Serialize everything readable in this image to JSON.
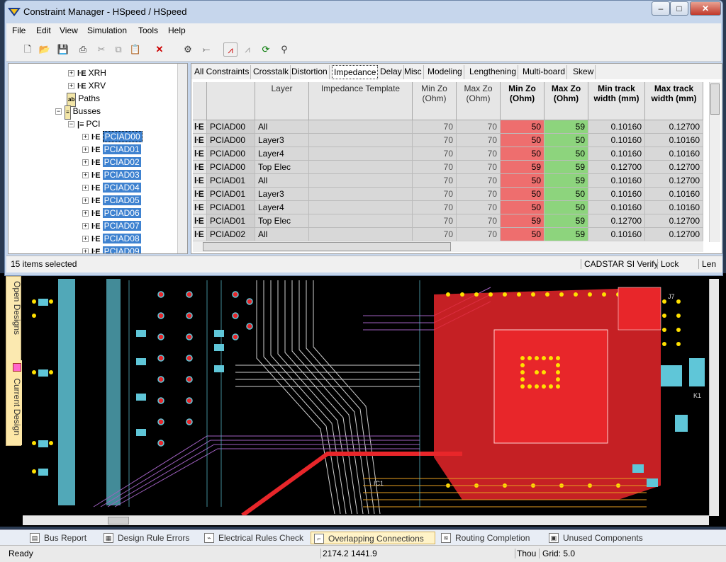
{
  "window": {
    "title": "Constraint Manager - HSpeed / HSpeed",
    "min": "–",
    "max": "□",
    "close": "✕"
  },
  "menu": [
    "File",
    "Edit",
    "View",
    "Simulation",
    "Tools",
    "Help"
  ],
  "tree": {
    "items": [
      {
        "label": "XRH",
        "type": "net",
        "sel": false
      },
      {
        "label": "XRV",
        "type": "net",
        "sel": false
      },
      {
        "label": "Paths",
        "type": "folder",
        "sel": false
      },
      {
        "label": "Busses",
        "type": "folder",
        "sel": false
      },
      {
        "label": "PCI",
        "type": "bus",
        "sel": false
      },
      {
        "label": "PCIAD00",
        "type": "net",
        "sel": true
      },
      {
        "label": "PCIAD01",
        "type": "net",
        "sel": true
      },
      {
        "label": "PCIAD02",
        "type": "net",
        "sel": true
      },
      {
        "label": "PCIAD03",
        "type": "net",
        "sel": true
      },
      {
        "label": "PCIAD04",
        "type": "net",
        "sel": true
      },
      {
        "label": "PCIAD05",
        "type": "net",
        "sel": true
      },
      {
        "label": "PCIAD06",
        "type": "net",
        "sel": true
      },
      {
        "label": "PCIAD07",
        "type": "net",
        "sel": true
      },
      {
        "label": "PCIAD08",
        "type": "net",
        "sel": true
      },
      {
        "label": "PCIAD09",
        "type": "net",
        "sel": true
      }
    ]
  },
  "tabs": [
    "All Constraints",
    "Crosstalk",
    "Distortion",
    "Impedance",
    "Delay",
    "Misc",
    "Modeling",
    "Lengthening",
    "Multi-board",
    "Skew"
  ],
  "active_tab": "Impedance",
  "grid": {
    "headers": [
      "Layer",
      "Impedance Template",
      "Min Zo (Ohm)",
      "Max Zo (Ohm)",
      "Min Zo (Ohm)",
      "Max Zo (Ohm)",
      "Min track width (mm)",
      "Max track width (mm)"
    ],
    "rows": [
      {
        "net": "PCIAD00",
        "layer": "All",
        "tmpl": "",
        "minzo": "70",
        "maxzo": "70",
        "minzo2": "50",
        "maxzo2": "59",
        "mintw": "0.10160",
        "maxtw": "0.12700"
      },
      {
        "net": "PCIAD00",
        "layer": "Layer3",
        "tmpl": "",
        "minzo": "70",
        "maxzo": "70",
        "minzo2": "50",
        "maxzo2": "50",
        "mintw": "0.10160",
        "maxtw": "0.10160"
      },
      {
        "net": "PCIAD00",
        "layer": "Layer4",
        "tmpl": "",
        "minzo": "70",
        "maxzo": "70",
        "minzo2": "50",
        "maxzo2": "50",
        "mintw": "0.10160",
        "maxtw": "0.10160"
      },
      {
        "net": "PCIAD00",
        "layer": "Top Elec",
        "tmpl": "",
        "minzo": "70",
        "maxzo": "70",
        "minzo2": "59",
        "maxzo2": "59",
        "mintw": "0.12700",
        "maxtw": "0.12700"
      },
      {
        "net": "PCIAD01",
        "layer": "All",
        "tmpl": "",
        "minzo": "70",
        "maxzo": "70",
        "minzo2": "50",
        "maxzo2": "59",
        "mintw": "0.10160",
        "maxtw": "0.12700"
      },
      {
        "net": "PCIAD01",
        "layer": "Layer3",
        "tmpl": "",
        "minzo": "70",
        "maxzo": "70",
        "minzo2": "50",
        "maxzo2": "50",
        "mintw": "0.10160",
        "maxtw": "0.10160"
      },
      {
        "net": "PCIAD01",
        "layer": "Layer4",
        "tmpl": "",
        "minzo": "70",
        "maxzo": "70",
        "minzo2": "50",
        "maxzo2": "50",
        "mintw": "0.10160",
        "maxtw": "0.10160"
      },
      {
        "net": "PCIAD01",
        "layer": "Top Elec",
        "tmpl": "",
        "minzo": "70",
        "maxzo": "70",
        "minzo2": "59",
        "maxzo2": "59",
        "mintw": "0.12700",
        "maxtw": "0.12700"
      },
      {
        "net": "PCIAD02",
        "layer": "All",
        "tmpl": "",
        "minzo": "70",
        "maxzo": "70",
        "minzo2": "50",
        "maxzo2": "59",
        "mintw": "0.10160",
        "maxtw": "0.12700"
      }
    ]
  },
  "win_status": {
    "selected": "15 items selected",
    "verify": "CADSTAR SI Verify",
    "lock": "Lock",
    "len": "Len"
  },
  "side_tabs": [
    "Open Designs",
    "Current Design"
  ],
  "bottom_tabs": [
    "Bus Report",
    "Design Rule Errors",
    "Electrical Rules Check",
    "Overlapping Connections",
    "Routing Completion",
    "Unused Components"
  ],
  "active_bottom_tab": "Overlapping Connections",
  "status": {
    "ready": "Ready",
    "coords": "2174.2  1441.9",
    "units": "Thou",
    "grid": "Grid: 5.0"
  },
  "pcb_labels": [
    "J7",
    "IC1",
    "K1"
  ],
  "colors": {
    "selection": "#3e82d0",
    "min_zo_fill": "#ee6e6e",
    "max_zo_fill": "#8dd47d",
    "pcb_red": "#e8262a",
    "pcb_cyan": "#5fc6d8",
    "pcb_yellow": "#ffe000"
  }
}
